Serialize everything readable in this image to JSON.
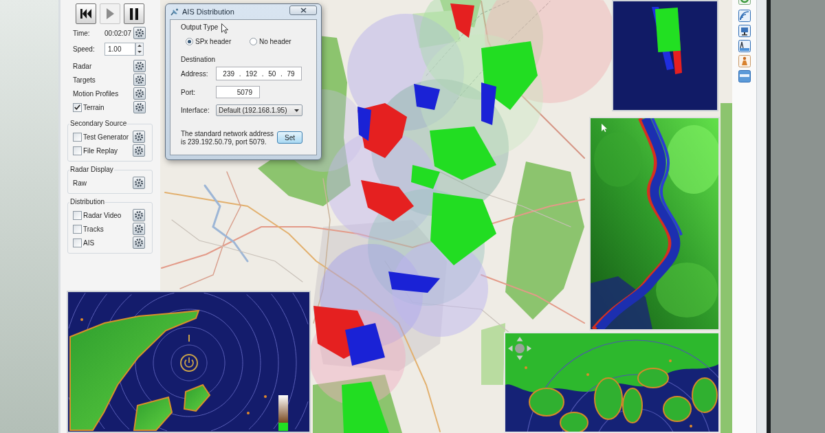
{
  "playback": {
    "buttons": [
      {
        "kind": "skip_back",
        "disabled": false
      },
      {
        "kind": "play",
        "disabled": true
      },
      {
        "kind": "pause",
        "disabled": false
      }
    ]
  },
  "controls": {
    "time": {
      "label": "Time:",
      "value": "00:02:07"
    },
    "speed": {
      "label": "Speed:",
      "value": "1.00"
    },
    "sources": [
      {
        "kind": "label",
        "label": "Radar"
      },
      {
        "kind": "label",
        "label": "Targets"
      },
      {
        "kind": "label",
        "label": "Motion Profiles"
      },
      {
        "kind": "checkbox",
        "label": "Terrain",
        "checked": true
      }
    ]
  },
  "groups": [
    {
      "title": "Secondary Source",
      "items": [
        {
          "kind": "checkbox",
          "label": "Test Generator",
          "checked": false
        },
        {
          "kind": "checkbox",
          "label": "File Replay",
          "checked": false
        }
      ]
    },
    {
      "title": "Radar Display",
      "items": [
        {
          "kind": "label",
          "label": "Raw"
        }
      ]
    },
    {
      "title": "Distribution",
      "items": [
        {
          "kind": "checkbox",
          "label": "Radar Video",
          "checked": false
        },
        {
          "kind": "checkbox",
          "label": "Tracks",
          "checked": false
        },
        {
          "kind": "checkbox",
          "label": "AIS",
          "checked": false
        }
      ]
    }
  ],
  "dialog": {
    "title": "AIS Distribution",
    "output_type": {
      "title": "Output Type",
      "options": [
        {
          "label": "SPx header",
          "selected": true
        },
        {
          "label": "No header",
          "selected": false
        }
      ]
    },
    "destination": {
      "title": "Destination",
      "fields": [
        {
          "kind": "ip",
          "label": "Address:",
          "octets": [
            "239",
            "192",
            "50",
            "79"
          ],
          "separator": "."
        },
        {
          "kind": "text",
          "label": "Port:",
          "value": "5079"
        },
        {
          "kind": "dropdown",
          "label": "Interface:",
          "value": "Default (192.168.1.95)"
        }
      ]
    },
    "note": "The standard network address is 239.192.50.79, port 5079.",
    "button": "Set"
  },
  "toolbar": [
    {
      "kind": "ring"
    },
    {
      "kind": "signal"
    },
    {
      "kind": "monitor"
    },
    {
      "kind": "antenna"
    },
    {
      "kind": "person"
    },
    {
      "kind": "window"
    }
  ]
}
